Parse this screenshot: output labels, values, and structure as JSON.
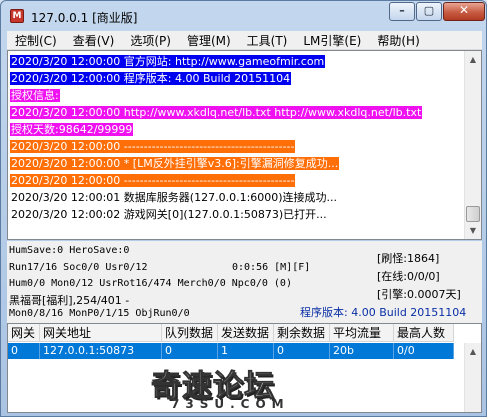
{
  "window": {
    "title": "127.0.0.1 [商业版]",
    "icon": "app-icon",
    "icon_glyph": "M",
    "buttons": {
      "minimize": "–",
      "maximize": "▢",
      "close": "✕"
    }
  },
  "menu": [
    {
      "label": "控制(C)"
    },
    {
      "label": "查看(V)"
    },
    {
      "label": "选项(P)"
    },
    {
      "label": "管理(M)"
    },
    {
      "label": "工具(T)"
    },
    {
      "label": "LM引擎(E)"
    },
    {
      "label": "帮助(H)"
    }
  ],
  "log": [
    {
      "style": "blue",
      "text": "2020/3/20 12:00:00 官方网站: http://www.gameofmir.com"
    },
    {
      "style": "blue",
      "text": "2020/3/20 12:00:00 程序版本: 4.00 Build 20151104"
    },
    {
      "style": "magenta",
      "text": "授权信息:"
    },
    {
      "style": "magenta",
      "text": "2020/3/20 12:00:00 http://www.xkdlq.net/lb.txt http://www.xkdlq.net/lb.txt"
    },
    {
      "style": "magenta",
      "text": "授权天数:98642/99999"
    },
    {
      "style": "orange",
      "text": "2020/3/20 12:00:00 -------------------------------------------"
    },
    {
      "style": "orange",
      "text": "2020/3/20 12:00:00 * [LM反外挂引擎v3.6]:引擎漏洞修复成功..."
    },
    {
      "style": "orange",
      "text": "2020/3/20 12:00:00 -------------------------------------------"
    },
    {
      "style": "normal",
      "text": "2020/3/20 12:00:01 数据库服务器(127.0.0.1:6000)连接成功..."
    },
    {
      "style": "normal",
      "text": "2020/3/20 12:00:02 游戏网关[0](127.0.0.1:50873)已打开..."
    }
  ],
  "log_colors": {
    "blue": "#0000f0",
    "magenta": "#f011f0",
    "orange": "#ff6e07"
  },
  "status": {
    "line1": "HumSave:0 HeroSave:0",
    "line2": "Run17/16 Soc0/0 Usr0/12",
    "timer": "0:0:56 [M][F]",
    "line3": "Hum0/0 Mon0/12 UsrRot16/474 Merch0/0 Npc0/0 (0)",
    "line4": "黑福哥[福利],254/401 -",
    "line5": "Mon0/8/16 MonP0/1/15 ObjRun0/0",
    "refresh": "[刷怪:1864]",
    "online": "[在线:0/0/0]",
    "engine": "[引擎:0.0007天]",
    "version": "程序版本: 4.00 Build 20151104"
  },
  "gateway_table": {
    "columns": [
      "网关",
      "网关地址",
      "队列数据",
      "发送数据",
      "剩余数据",
      "平均流量",
      "最高人数"
    ],
    "rows": [
      [
        "0",
        "127.0.0.1:50873",
        "0",
        "1",
        "0",
        "20b",
        "0/0"
      ]
    ]
  },
  "watermark": {
    "main": "奇速论坛",
    "sub": "73SU.COM"
  }
}
